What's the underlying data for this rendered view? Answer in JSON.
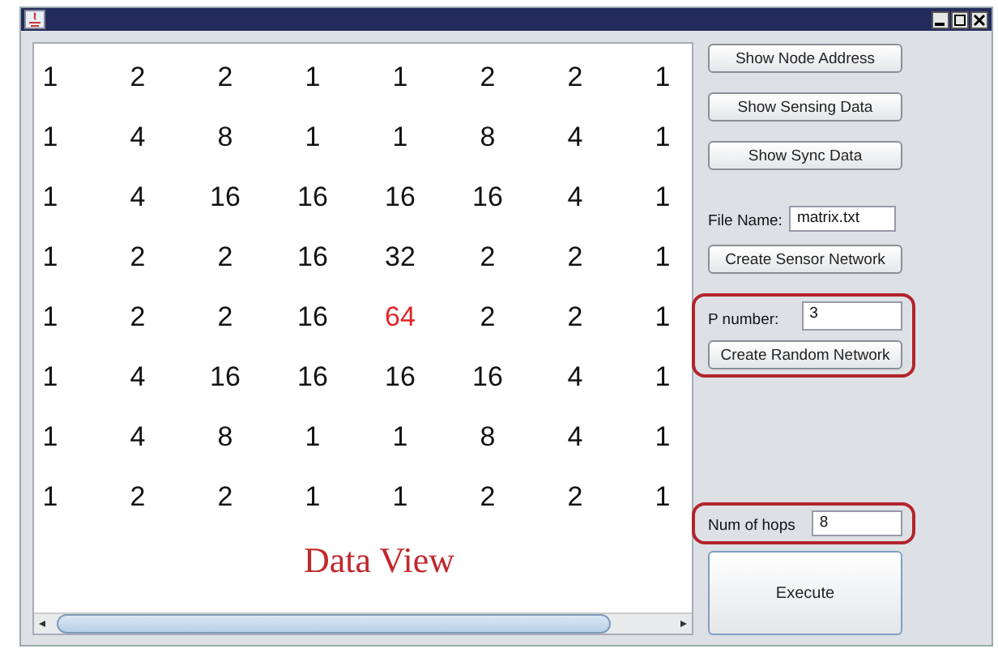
{
  "grid": [
    [
      {
        "value": "1",
        "highlighted": false
      },
      {
        "value": "2",
        "highlighted": false
      },
      {
        "value": "2",
        "highlighted": false
      },
      {
        "value": "1",
        "highlighted": false
      },
      {
        "value": "1",
        "highlighted": false
      },
      {
        "value": "2",
        "highlighted": false
      },
      {
        "value": "2",
        "highlighted": false
      },
      {
        "value": "1",
        "highlighted": false
      }
    ],
    [
      {
        "value": "1",
        "highlighted": false
      },
      {
        "value": "4",
        "highlighted": false
      },
      {
        "value": "8",
        "highlighted": false
      },
      {
        "value": "1",
        "highlighted": false
      },
      {
        "value": "1",
        "highlighted": false
      },
      {
        "value": "8",
        "highlighted": false
      },
      {
        "value": "4",
        "highlighted": false
      },
      {
        "value": "1",
        "highlighted": false
      }
    ],
    [
      {
        "value": "1",
        "highlighted": false
      },
      {
        "value": "4",
        "highlighted": false
      },
      {
        "value": "16",
        "highlighted": false
      },
      {
        "value": "16",
        "highlighted": false
      },
      {
        "value": "16",
        "highlighted": false
      },
      {
        "value": "16",
        "highlighted": false
      },
      {
        "value": "4",
        "highlighted": false
      },
      {
        "value": "1",
        "highlighted": false
      }
    ],
    [
      {
        "value": "1",
        "highlighted": false
      },
      {
        "value": "2",
        "highlighted": false
      },
      {
        "value": "2",
        "highlighted": false
      },
      {
        "value": "16",
        "highlighted": false
      },
      {
        "value": "32",
        "highlighted": false
      },
      {
        "value": "2",
        "highlighted": false
      },
      {
        "value": "2",
        "highlighted": false
      },
      {
        "value": "1",
        "highlighted": false
      }
    ],
    [
      {
        "value": "1",
        "highlighted": false
      },
      {
        "value": "2",
        "highlighted": false
      },
      {
        "value": "2",
        "highlighted": false
      },
      {
        "value": "16",
        "highlighted": false
      },
      {
        "value": "64",
        "highlighted": true
      },
      {
        "value": "2",
        "highlighted": false
      },
      {
        "value": "2",
        "highlighted": false
      },
      {
        "value": "1",
        "highlighted": false
      }
    ],
    [
      {
        "value": "1",
        "highlighted": false
      },
      {
        "value": "4",
        "highlighted": false
      },
      {
        "value": "16",
        "highlighted": false
      },
      {
        "value": "16",
        "highlighted": false
      },
      {
        "value": "16",
        "highlighted": false
      },
      {
        "value": "16",
        "highlighted": false
      },
      {
        "value": "4",
        "highlighted": false
      },
      {
        "value": "1",
        "highlighted": false
      }
    ],
    [
      {
        "value": "1",
        "highlighted": false
      },
      {
        "value": "4",
        "highlighted": false
      },
      {
        "value": "8",
        "highlighted": false
      },
      {
        "value": "1",
        "highlighted": false
      },
      {
        "value": "1",
        "highlighted": false
      },
      {
        "value": "8",
        "highlighted": false
      },
      {
        "value": "4",
        "highlighted": false
      },
      {
        "value": "1",
        "highlighted": false
      }
    ],
    [
      {
        "value": "1",
        "highlighted": false
      },
      {
        "value": "2",
        "highlighted": false
      },
      {
        "value": "2",
        "highlighted": false
      },
      {
        "value": "1",
        "highlighted": false
      },
      {
        "value": "1",
        "highlighted": false
      },
      {
        "value": "2",
        "highlighted": false
      },
      {
        "value": "2",
        "highlighted": false
      },
      {
        "value": "1",
        "highlighted": false
      }
    ]
  ],
  "data_view_caption": "Data View",
  "controls": [
    {
      "kind": "button",
      "label": "Show Node Address",
      "annotated": false
    },
    {
      "kind": "button",
      "label": "Show Sensing Data",
      "annotated": false
    },
    {
      "kind": "button",
      "label": "Show Sync Data",
      "annotated": false
    },
    {
      "kind": "field",
      "label": "File Name:",
      "value": "matrix.txt",
      "annotated": false
    },
    {
      "kind": "button",
      "label": "Create Sensor Network",
      "annotated": false
    },
    {
      "kind": "group",
      "annotated": true,
      "items": [
        {
          "kind": "field",
          "label": "P number:",
          "value": "3"
        },
        {
          "kind": "button",
          "label": "Create Random Network"
        }
      ]
    },
    {
      "kind": "group",
      "annotated": true,
      "items": [
        {
          "kind": "field",
          "label": "Num of hops",
          "value": "8"
        }
      ]
    },
    {
      "kind": "bigbutton",
      "label": "Execute",
      "annotated": false
    }
  ]
}
